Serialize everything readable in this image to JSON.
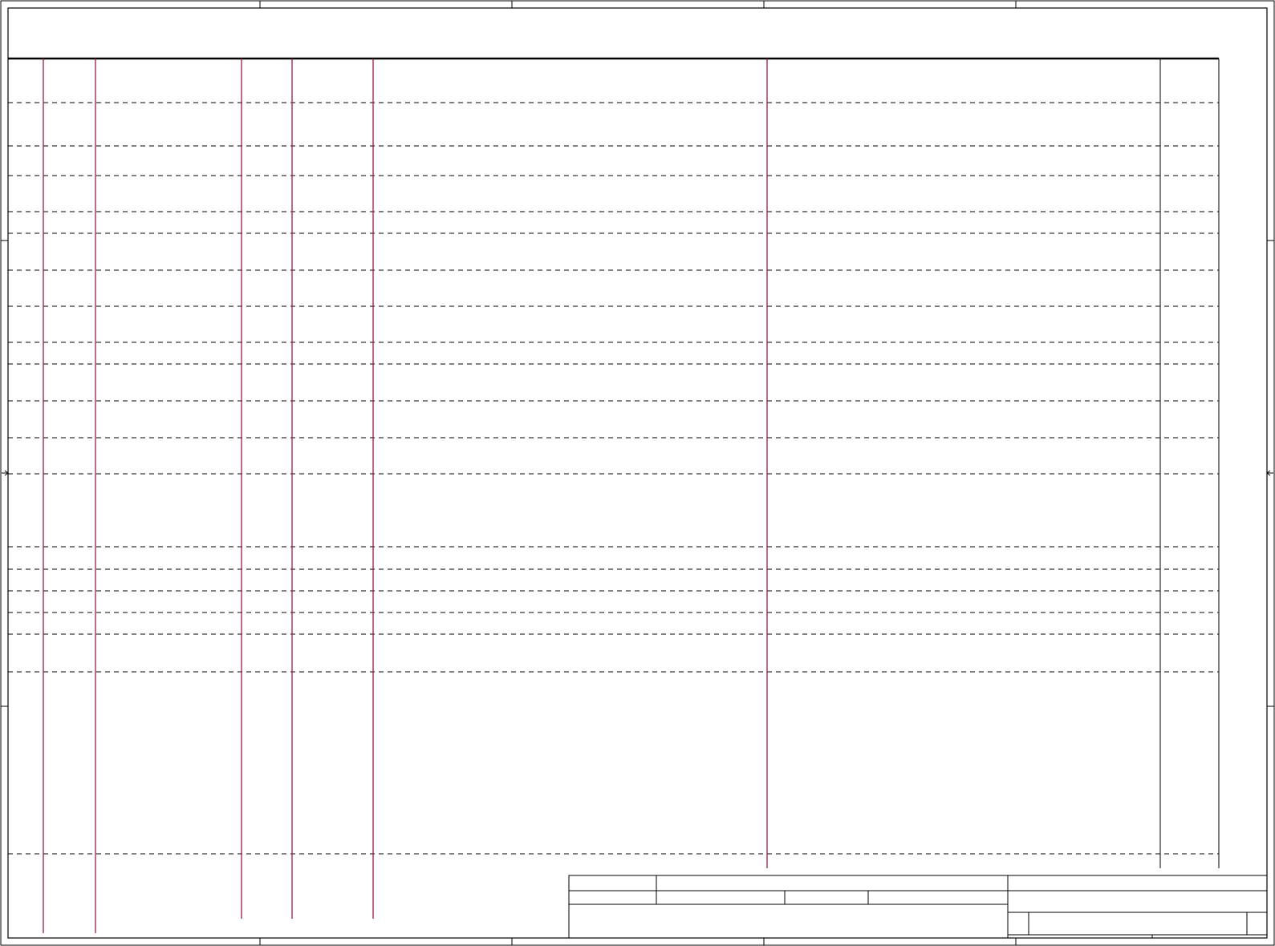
{
  "document": {
    "type": "blank drawing sheet with table frame",
    "orientation": "landscape"
  },
  "table": {
    "visible_text": []
  },
  "title_block": {
    "visible_text": []
  },
  "colors": {
    "frame": "#000000",
    "column_rule": "#9b1b4a",
    "row_rule": "#000000",
    "background": "#ffffff"
  }
}
